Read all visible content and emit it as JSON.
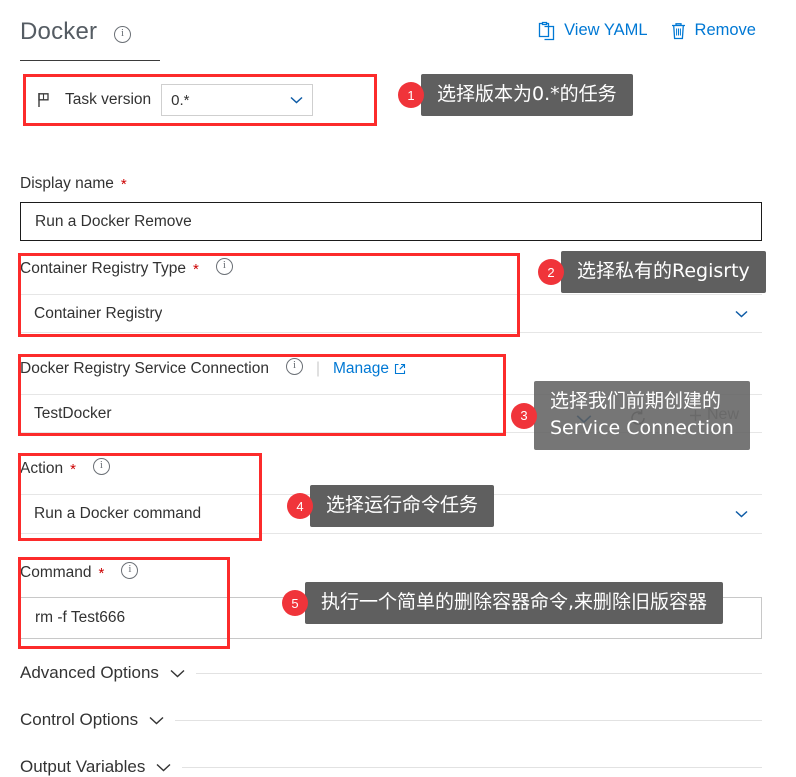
{
  "header": {
    "title": "Docker",
    "info_icon": "info-icon",
    "view_yaml": "View YAML",
    "remove": "Remove",
    "view_yaml_icon": "clipboard-icon",
    "remove_icon": "trash-icon"
  },
  "task_version": {
    "icon": "flag-icon",
    "label": "Task version",
    "value": "0.*",
    "chevron": "chevron-down-icon"
  },
  "fields": {
    "display_name": {
      "label": "Display name",
      "required": "*",
      "value": "Run a Docker Remove"
    },
    "registry_type": {
      "label": "Container Registry Type",
      "required": "*",
      "value": "Container Registry",
      "chevron": "chevron-down-icon"
    },
    "service_connection": {
      "label": "Docker Registry Service Connection",
      "separator": "|",
      "manage": "Manage",
      "manage_icon": "external-link-icon",
      "value": "TestDocker",
      "chevron": "chevron-down-icon",
      "refresh_icon": "refresh-icon",
      "new_label": "New",
      "new_icon": "plus-icon"
    },
    "action": {
      "label": "Action",
      "required": "*",
      "value": "Run a Docker command",
      "chevron": "chevron-down-icon"
    },
    "command": {
      "label": "Command",
      "required": "*",
      "value": "rm -f Test666"
    }
  },
  "sections": [
    {
      "title": "Advanced Options",
      "chevron": "chevron-down-icon"
    },
    {
      "title": "Control Options",
      "chevron": "chevron-down-icon"
    },
    {
      "title": "Output Variables",
      "chevron": "chevron-down-icon"
    }
  ],
  "callouts": [
    {
      "number": "1",
      "text": "选择版本为0.*的任务"
    },
    {
      "number": "2",
      "text": "选择私有的Regisrty"
    },
    {
      "number": "3",
      "text": "选择我们前期创建的\nService Connection"
    },
    {
      "number": "4",
      "text": "选择运行命令任务"
    },
    {
      "number": "5",
      "text": "执行一个简单的删除容器命令,来删除旧版容器"
    }
  ],
  "colors": {
    "accent_link": "#0078d4",
    "highlight_box": "#fc2b2b",
    "badge": "#f0343a",
    "callout_bg": "#5f5f5f"
  }
}
